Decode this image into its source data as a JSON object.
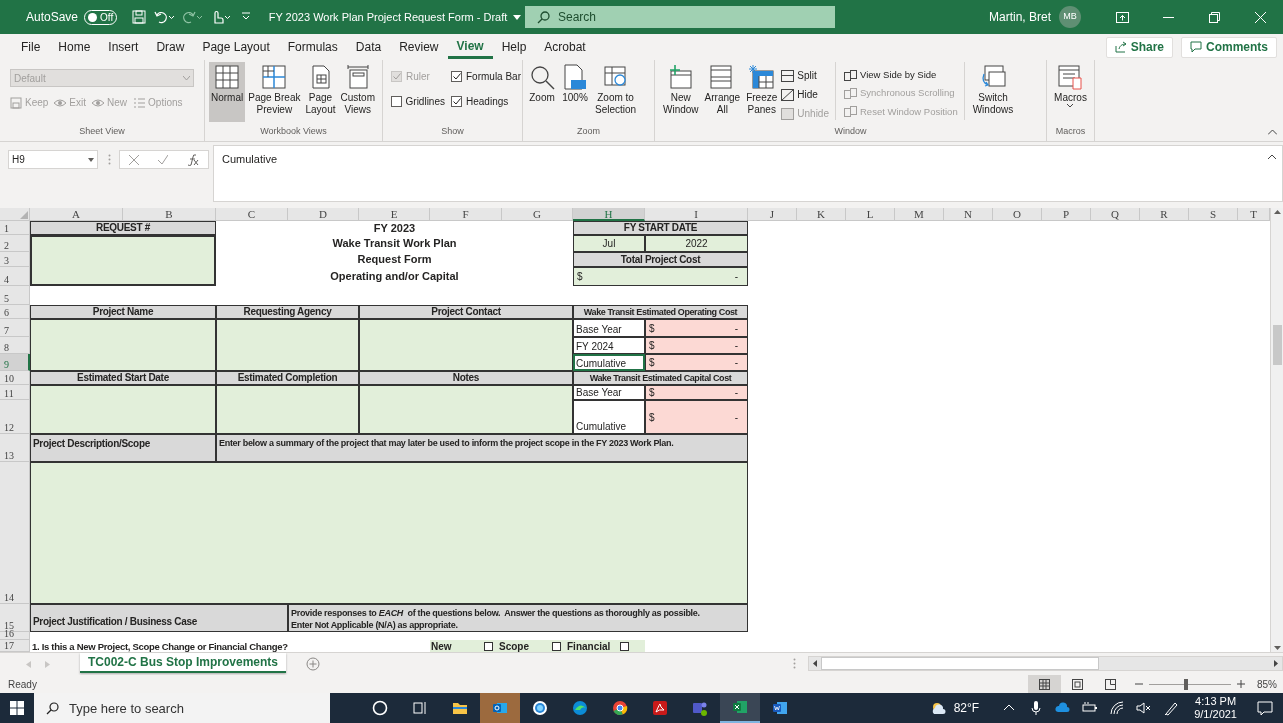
{
  "title_bar": {
    "autosave_label": "AutoSave",
    "autosave": {
      "on": false,
      "label": "Off"
    },
    "title": "FY 2023 Work Plan Project Request Form - Draft",
    "search_placeholder": "Search",
    "user_name": "Martin, Bret",
    "user_initials": "MB"
  },
  "menu_tabs": [
    {
      "label": "File",
      "selected": false
    },
    {
      "label": "Home",
      "selected": false
    },
    {
      "label": "Insert",
      "selected": false
    },
    {
      "label": "Draw",
      "selected": false
    },
    {
      "label": "Page Layout",
      "selected": false
    },
    {
      "label": "Formulas",
      "selected": false
    },
    {
      "label": "Data",
      "selected": false
    },
    {
      "label": "Review",
      "selected": false
    },
    {
      "label": "View",
      "selected": true
    },
    {
      "label": "Help",
      "selected": false
    },
    {
      "label": "Acrobat",
      "selected": false
    }
  ],
  "share_label": "Share",
  "comments_label": "Comments",
  "ribbon": {
    "sheet_view": {
      "style_value": "Default",
      "buttons": [
        {
          "label": "Keep",
          "disabled": true
        },
        {
          "label": "Exit",
          "disabled": true
        },
        {
          "label": "New",
          "disabled": true
        },
        {
          "label": "Options",
          "disabled": true
        }
      ],
      "label": "Sheet View"
    },
    "workbook_views": {
      "buttons": [
        {
          "label": "Normal",
          "selected": true
        },
        {
          "label": "Page Break\nPreview",
          "selected": false
        },
        {
          "label": "Page\nLayout",
          "selected": false
        },
        {
          "label": "Custom\nViews",
          "selected": false
        }
      ],
      "label": "Workbook Views"
    },
    "show": {
      "options": [
        {
          "label": "Ruler",
          "checked": true,
          "disabled": true
        },
        {
          "label": "Formula Bar",
          "checked": true,
          "disabled": false
        },
        {
          "label": "Gridlines",
          "checked": false,
          "disabled": false
        },
        {
          "label": "Headings",
          "checked": true,
          "disabled": false
        }
      ],
      "label": "Show"
    },
    "zoom": {
      "buttons": [
        "Zoom",
        "100%",
        "Zoom to\nSelection"
      ],
      "label": "Zoom"
    },
    "window": {
      "large_buttons": [
        "New\nWindow",
        "Arrange\nAll",
        "Freeze\nPanes"
      ],
      "small_buttons": [
        {
          "label": "Split",
          "disabled": false
        },
        {
          "label": "Hide",
          "disabled": false
        },
        {
          "label": "Unhide",
          "disabled": true
        }
      ],
      "side_buttons": [
        {
          "label": "View Side by Side",
          "disabled": false
        },
        {
          "label": "Synchronous Scrolling",
          "disabled": true
        },
        {
          "label": "Reset Window Position",
          "disabled": true
        }
      ],
      "switch_label": "Switch\nWindows",
      "label": "Window"
    },
    "macros": {
      "button": "Macros",
      "label": "Macros"
    }
  },
  "formula_bar": {
    "name_box": "H9",
    "formula": "Cumulative"
  },
  "columns": [
    {
      "label": "A",
      "selected": false
    },
    {
      "label": "B",
      "selected": false
    },
    {
      "label": "C",
      "selected": false
    },
    {
      "label": "D",
      "selected": false
    },
    {
      "label": "E",
      "selected": false
    },
    {
      "label": "F",
      "selected": false
    },
    {
      "label": "G",
      "selected": false
    },
    {
      "label": "H",
      "selected": true
    },
    {
      "label": "I",
      "selected": false
    },
    {
      "label": "J",
      "selected": false
    },
    {
      "label": "K",
      "selected": false
    },
    {
      "label": "L",
      "selected": false
    },
    {
      "label": "M",
      "selected": false
    },
    {
      "label": "N",
      "selected": false
    },
    {
      "label": "O",
      "selected": false
    },
    {
      "label": "P",
      "selected": false
    },
    {
      "label": "Q",
      "selected": false
    },
    {
      "label": "R",
      "selected": false
    },
    {
      "label": "S",
      "selected": false
    },
    {
      "label": "T",
      "selected": false
    }
  ],
  "rows": [
    {
      "label": "1",
      "selected": false
    },
    {
      "label": "2",
      "selected": false
    },
    {
      "label": "3",
      "selected": false
    },
    {
      "label": "4",
      "selected": false
    },
    {
      "label": "5",
      "selected": false
    },
    {
      "label": "6",
      "selected": false
    },
    {
      "label": "7",
      "selected": false
    },
    {
      "label": "8",
      "selected": false
    },
    {
      "label": "9",
      "selected": true
    },
    {
      "label": "10",
      "selected": false
    },
    {
      "label": "11",
      "selected": false
    },
    {
      "label": "12",
      "selected": false
    },
    {
      "label": "13",
      "selected": false
    },
    {
      "label": "14",
      "selected": false
    },
    {
      "label": "15",
      "selected": false
    },
    {
      "label": "16",
      "selected": false
    },
    {
      "label": "17",
      "selected": false
    }
  ],
  "cells": [
    {
      "kind": "header",
      "text": "REQUEST #",
      "selected": false
    },
    {
      "kind": "input",
      "selected": false
    },
    {
      "kind": "title",
      "text": "FY 2023",
      "selected": false
    },
    {
      "kind": "title",
      "text": "Wake Transit Work Plan",
      "selected": false
    },
    {
      "kind": "title",
      "text": "Request Form",
      "selected": false
    },
    {
      "kind": "title",
      "text": "Operating and/or Capital",
      "selected": false
    },
    {
      "kind": "header",
      "text": "FY START DATE",
      "selected": false
    },
    {
      "kind": "input",
      "text": "Jul",
      "selected": false
    },
    {
      "kind": "input",
      "text": "2022",
      "selected": false
    },
    {
      "kind": "header",
      "text": "Total Project Cost",
      "selected": false
    },
    {
      "kind": "total",
      "currency": "$",
      "value": "-",
      "selected": false
    },
    {
      "kind": "header",
      "text": "Project Name",
      "selected": false
    },
    {
      "kind": "header",
      "text": "Requesting Agency",
      "selected": false
    },
    {
      "kind": "header",
      "text": "Project Contact",
      "selected": false
    },
    {
      "kind": "header",
      "text": "Wake Transit Estimated Operating Cost",
      "selected": false
    },
    {
      "kind": "input",
      "selected": false
    },
    {
      "kind": "input",
      "selected": false
    },
    {
      "kind": "input",
      "selected": false
    },
    {
      "kind": "label",
      "text": "Base Year",
      "selected": false
    },
    {
      "kind": "amount",
      "currency": "$",
      "value": "-",
      "selected": false
    },
    {
      "kind": "label",
      "text": "FY 2024",
      "selected": false
    },
    {
      "kind": "amount",
      "currency": "$",
      "value": "-",
      "selected": false
    },
    {
      "kind": "label",
      "text": "Cumulative",
      "selected": true
    },
    {
      "kind": "amount",
      "currency": "$",
      "value": "-",
      "selected": false
    },
    {
      "kind": "header",
      "text": "Estimated Start Date",
      "selected": false
    },
    {
      "kind": "header",
      "text": "Estimated Completion",
      "selected": false
    },
    {
      "kind": "header",
      "text": "Notes",
      "selected": false
    },
    {
      "kind": "header",
      "text": "Wake Transit Estimated Capital Cost",
      "selected": false
    },
    {
      "kind": "input",
      "selected": false
    },
    {
      "kind": "input",
      "selected": false
    },
    {
      "kind": "input",
      "selected": false
    },
    {
      "kind": "label",
      "text": "Base Year",
      "selected": false
    },
    {
      "kind": "amount",
      "currency": "$",
      "value": "-",
      "selected": false
    },
    {
      "kind": "label",
      "text": "Cumulative",
      "selected": false
    },
    {
      "kind": "amount",
      "currency": "$",
      "value": "-",
      "selected": false
    },
    {
      "kind": "header",
      "text": "Project Description/Scope",
      "selected": false
    },
    {
      "kind": "header",
      "text": "Enter below a summary of the project that may later be used to inform the project scope in the FY 2023 Work Plan.",
      "selected": false
    },
    {
      "kind": "input",
      "selected": false
    },
    {
      "kind": "header",
      "text": "Project Justification / Business Case",
      "selected": false
    },
    {
      "kind": "header",
      "text": "Provide responses to *EACH*  of the questions below.  Answer the questions as thoroughly as possible.\nEnter Not Applicable (N/A) as appropriate.",
      "selected": false
    },
    {
      "kind": "plain",
      "text": "1.  Is this a New Project, Scope Change or Financial Change?",
      "selected": false
    }
  ],
  "question_options": [
    {
      "label": "New",
      "checked": false
    },
    {
      "label": "Scope",
      "checked": false
    },
    {
      "label": "Financial",
      "checked": false
    }
  ],
  "sheet_tabs": [
    {
      "label": "TC002-C Bus Stop Improvements",
      "selected": true
    }
  ],
  "status_bar": {
    "status": "Ready",
    "zoom": {
      "level": 0.45,
      "reading": "85%"
    }
  },
  "taskbar": {
    "search_placeholder": "Type here to search",
    "weather": "82°F",
    "time": "4:13 PM",
    "date": "9/1/2021"
  }
}
